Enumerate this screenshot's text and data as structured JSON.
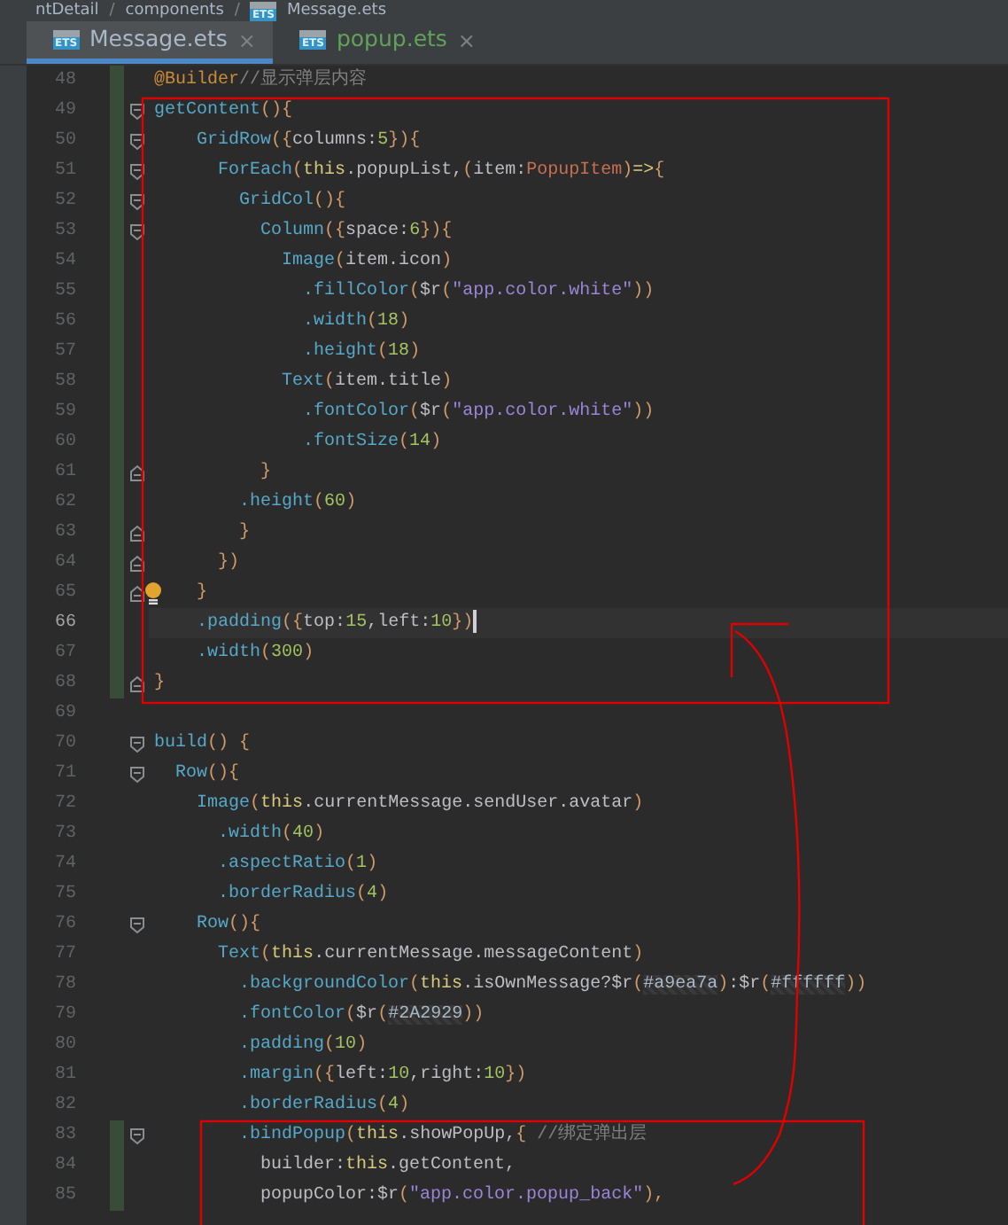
{
  "breadcrumb": [
    {
      "text": "ntDetail"
    },
    {
      "text": "/",
      "kind": "sep"
    },
    {
      "text": "components"
    },
    {
      "text": "/",
      "kind": "sep"
    },
    {
      "text": "Message.ets",
      "icon_label": "ETS"
    }
  ],
  "tabs": [
    {
      "label": "Message.ets",
      "icon_label": "ETS",
      "close": "×",
      "selected": true,
      "modified": false
    },
    {
      "label": "popup.ets",
      "icon_label": "ETS",
      "close": "×",
      "selected": false,
      "modified": true
    }
  ],
  "lines": [
    {
      "number": "48",
      "changed": true,
      "fold_start": false,
      "fold_end": false,
      "tokens": [
        {
          "kind": "ann",
          "text": "@Builder"
        },
        {
          "kind": "cmt",
          "text": "//显示弹层内容"
        }
      ]
    },
    {
      "number": "49",
      "changed": true,
      "fold_start": true,
      "fold_end": false,
      "tokens": [
        {
          "kind": "fn",
          "text": "getContent"
        },
        {
          "kind": "br",
          "text": "(){"
        }
      ]
    },
    {
      "number": "50",
      "changed": true,
      "fold_start": true,
      "fold_end": false,
      "tokens": [
        {
          "kind": "fn",
          "text": "    GridRow"
        },
        {
          "kind": "br",
          "text": "({"
        },
        {
          "kind": "pl",
          "text": "columns:"
        },
        {
          "kind": "num",
          "text": "5"
        },
        {
          "kind": "br",
          "text": "}){"
        }
      ]
    },
    {
      "number": "51",
      "changed": true,
      "fold_start": true,
      "fold_end": false,
      "tokens": [
        {
          "kind": "fn",
          "text": "      ForEach"
        },
        {
          "kind": "br",
          "text": "("
        },
        {
          "kind": "kw",
          "text": "this"
        },
        {
          "kind": "pl",
          "text": ".popupList,"
        },
        {
          "kind": "br",
          "text": "("
        },
        {
          "kind": "pl",
          "text": "item:"
        },
        {
          "kind": "type",
          "text": "PopupItem"
        },
        {
          "kind": "br",
          "text": ")"
        },
        {
          "kind": "kw",
          "text": "=>"
        },
        {
          "kind": "br",
          "text": "{"
        }
      ]
    },
    {
      "number": "52",
      "changed": true,
      "fold_start": true,
      "fold_end": false,
      "tokens": [
        {
          "kind": "fn",
          "text": "        GridCol"
        },
        {
          "kind": "br",
          "text": "(){"
        }
      ]
    },
    {
      "number": "53",
      "changed": true,
      "fold_start": true,
      "fold_end": false,
      "tokens": [
        {
          "kind": "fn",
          "text": "          Column"
        },
        {
          "kind": "br",
          "text": "({"
        },
        {
          "kind": "pl",
          "text": "space:"
        },
        {
          "kind": "num",
          "text": "6"
        },
        {
          "kind": "br",
          "text": "}){"
        }
      ]
    },
    {
      "number": "54",
      "changed": true,
      "fold_start": false,
      "fold_end": false,
      "tokens": [
        {
          "kind": "fn",
          "text": "            Image"
        },
        {
          "kind": "br",
          "text": "("
        },
        {
          "kind": "pl",
          "text": "item.icon"
        },
        {
          "kind": "br",
          "text": ")"
        }
      ]
    },
    {
      "number": "55",
      "changed": true,
      "fold_start": false,
      "fold_end": false,
      "tokens": [
        {
          "kind": "fn",
          "text": "              .fillColor"
        },
        {
          "kind": "br",
          "text": "("
        },
        {
          "kind": "pl",
          "text": "$r"
        },
        {
          "kind": "br",
          "text": "("
        },
        {
          "kind": "str",
          "text": "\"app.color.white\""
        },
        {
          "kind": "br",
          "text": "))"
        }
      ]
    },
    {
      "number": "56",
      "changed": true,
      "fold_start": false,
      "fold_end": false,
      "tokens": [
        {
          "kind": "fn",
          "text": "              .width"
        },
        {
          "kind": "br",
          "text": "("
        },
        {
          "kind": "num",
          "text": "18"
        },
        {
          "kind": "br",
          "text": ")"
        }
      ]
    },
    {
      "number": "57",
      "changed": true,
      "fold_start": false,
      "fold_end": false,
      "tokens": [
        {
          "kind": "fn",
          "text": "              .height"
        },
        {
          "kind": "br",
          "text": "("
        },
        {
          "kind": "num",
          "text": "18"
        },
        {
          "kind": "br",
          "text": ")"
        }
      ]
    },
    {
      "number": "58",
      "changed": true,
      "fold_start": false,
      "fold_end": false,
      "tokens": [
        {
          "kind": "fn",
          "text": "            Text"
        },
        {
          "kind": "br",
          "text": "("
        },
        {
          "kind": "pl",
          "text": "item.title"
        },
        {
          "kind": "br",
          "text": ")"
        }
      ]
    },
    {
      "number": "59",
      "changed": true,
      "fold_start": false,
      "fold_end": false,
      "tokens": [
        {
          "kind": "fn",
          "text": "              .fontColor"
        },
        {
          "kind": "br",
          "text": "("
        },
        {
          "kind": "pl",
          "text": "$r"
        },
        {
          "kind": "br",
          "text": "("
        },
        {
          "kind": "str",
          "text": "\"app.color.white\""
        },
        {
          "kind": "br",
          "text": "))"
        }
      ]
    },
    {
      "number": "60",
      "changed": true,
      "fold_start": false,
      "fold_end": false,
      "tokens": [
        {
          "kind": "fn",
          "text": "              .fontSize"
        },
        {
          "kind": "br",
          "text": "("
        },
        {
          "kind": "num",
          "text": "14"
        },
        {
          "kind": "br",
          "text": ")"
        }
      ]
    },
    {
      "number": "61",
      "changed": true,
      "fold_start": false,
      "fold_end": true,
      "tokens": [
        {
          "kind": "br",
          "text": "          }"
        }
      ]
    },
    {
      "number": "62",
      "changed": true,
      "fold_start": false,
      "fold_end": false,
      "tokens": [
        {
          "kind": "fn",
          "text": "        .height"
        },
        {
          "kind": "br",
          "text": "("
        },
        {
          "kind": "num",
          "text": "60"
        },
        {
          "kind": "br",
          "text": ")"
        }
      ]
    },
    {
      "number": "63",
      "changed": true,
      "fold_start": false,
      "fold_end": true,
      "tokens": [
        {
          "kind": "br",
          "text": "        }"
        }
      ]
    },
    {
      "number": "64",
      "changed": true,
      "fold_start": false,
      "fold_end": true,
      "tokens": [
        {
          "kind": "br",
          "text": "      })"
        }
      ]
    },
    {
      "number": "65",
      "changed": true,
      "fold_start": false,
      "fold_end": true,
      "bulb": true,
      "tokens": [
        {
          "kind": "br",
          "text": "    }"
        }
      ]
    },
    {
      "number": "66",
      "changed": true,
      "fold_start": false,
      "fold_end": false,
      "current": true,
      "tokens": [
        {
          "kind": "fn",
          "text": "    .padding"
        },
        {
          "kind": "br",
          "text": "({"
        },
        {
          "kind": "pl",
          "text": "top:"
        },
        {
          "kind": "num",
          "text": "15"
        },
        {
          "kind": "pl",
          "text": ",left:"
        },
        {
          "kind": "num",
          "text": "10"
        },
        {
          "kind": "br",
          "text": "})"
        }
      ]
    },
    {
      "number": "67",
      "changed": true,
      "fold_start": false,
      "fold_end": false,
      "tokens": [
        {
          "kind": "fn",
          "text": "    .width"
        },
        {
          "kind": "br",
          "text": "("
        },
        {
          "kind": "num",
          "text": "300"
        },
        {
          "kind": "br",
          "text": ")"
        }
      ]
    },
    {
      "number": "68",
      "changed": true,
      "fold_start": false,
      "fold_end": true,
      "tokens": [
        {
          "kind": "br",
          "text": "}"
        }
      ]
    },
    {
      "number": "69",
      "changed": false,
      "fold_start": false,
      "fold_end": false
    },
    {
      "number": "70",
      "changed": false,
      "fold_start": true,
      "fold_end": false,
      "tokens": [
        {
          "kind": "fn",
          "text": "build"
        },
        {
          "kind": "br",
          "text": "() {"
        }
      ]
    },
    {
      "number": "71",
      "changed": false,
      "fold_start": true,
      "fold_end": false,
      "tokens": [
        {
          "kind": "fn",
          "text": "  Row"
        },
        {
          "kind": "br",
          "text": "(){"
        }
      ]
    },
    {
      "number": "72",
      "changed": false,
      "fold_start": false,
      "fold_end": false,
      "tokens": [
        {
          "kind": "fn",
          "text": "    Image"
        },
        {
          "kind": "br",
          "text": "("
        },
        {
          "kind": "kw",
          "text": "this"
        },
        {
          "kind": "pl",
          "text": ".currentMessage.sendUser.avatar"
        },
        {
          "kind": "br",
          "text": ")"
        }
      ]
    },
    {
      "number": "73",
      "changed": false,
      "fold_start": false,
      "fold_end": false,
      "tokens": [
        {
          "kind": "fn",
          "text": "      .width"
        },
        {
          "kind": "br",
          "text": "("
        },
        {
          "kind": "num",
          "text": "40"
        },
        {
          "kind": "br",
          "text": ")"
        }
      ]
    },
    {
      "number": "74",
      "changed": false,
      "fold_start": false,
      "fold_end": false,
      "tokens": [
        {
          "kind": "fn",
          "text": "      .aspectRatio"
        },
        {
          "kind": "br",
          "text": "("
        },
        {
          "kind": "num",
          "text": "1"
        },
        {
          "kind": "br",
          "text": ")"
        }
      ]
    },
    {
      "number": "75",
      "changed": false,
      "fold_start": false,
      "fold_end": false,
      "tokens": [
        {
          "kind": "fn",
          "text": "      .borderRadius"
        },
        {
          "kind": "br",
          "text": "("
        },
        {
          "kind": "num",
          "text": "4"
        },
        {
          "kind": "br",
          "text": ")"
        }
      ]
    },
    {
      "number": "76",
      "changed": false,
      "fold_start": true,
      "fold_end": false,
      "tokens": [
        {
          "kind": "fn",
          "text": "    Row"
        },
        {
          "kind": "br",
          "text": "(){"
        }
      ]
    },
    {
      "number": "77",
      "changed": false,
      "fold_start": false,
      "fold_end": false,
      "tokens": [
        {
          "kind": "fn",
          "text": "      Text"
        },
        {
          "kind": "br",
          "text": "("
        },
        {
          "kind": "kw",
          "text": "this"
        },
        {
          "kind": "pl",
          "text": ".currentMessage.messageContent"
        },
        {
          "kind": "br",
          "text": ")"
        }
      ]
    },
    {
      "number": "78",
      "changed": false,
      "fold_start": false,
      "fold_end": false,
      "tokens": [
        {
          "kind": "fn",
          "text": "        .backgroundColor"
        },
        {
          "kind": "br",
          "text": "("
        },
        {
          "kind": "kw",
          "text": "this"
        },
        {
          "kind": "pl",
          "text": ".isOwnMessage?$r"
        },
        {
          "kind": "br",
          "text": "("
        },
        {
          "kind": "hex",
          "text": "#a9ea7a"
        },
        {
          "kind": "br",
          "text": ")"
        },
        {
          "kind": "pl",
          "text": ":$r"
        },
        {
          "kind": "br",
          "text": "("
        },
        {
          "kind": "hex",
          "text": "#ffffff"
        },
        {
          "kind": "br",
          "text": "))"
        }
      ]
    },
    {
      "number": "79",
      "changed": false,
      "fold_start": false,
      "fold_end": false,
      "tokens": [
        {
          "kind": "fn",
          "text": "        .fontColor"
        },
        {
          "kind": "br",
          "text": "("
        },
        {
          "kind": "pl",
          "text": "$r"
        },
        {
          "kind": "br",
          "text": "("
        },
        {
          "kind": "hex",
          "text": "#2A2929"
        },
        {
          "kind": "br",
          "text": "))"
        }
      ]
    },
    {
      "number": "80",
      "changed": false,
      "fold_start": false,
      "fold_end": false,
      "tokens": [
        {
          "kind": "fn",
          "text": "        .padding"
        },
        {
          "kind": "br",
          "text": "("
        },
        {
          "kind": "num",
          "text": "10"
        },
        {
          "kind": "br",
          "text": ")"
        }
      ]
    },
    {
      "number": "81",
      "changed": false,
      "fold_start": false,
      "fold_end": false,
      "tokens": [
        {
          "kind": "fn",
          "text": "        .margin"
        },
        {
          "kind": "br",
          "text": "({"
        },
        {
          "kind": "pl",
          "text": "left:"
        },
        {
          "kind": "num",
          "text": "10"
        },
        {
          "kind": "pl",
          "text": ",right:"
        },
        {
          "kind": "num",
          "text": "10"
        },
        {
          "kind": "br",
          "text": "})"
        }
      ]
    },
    {
      "number": "82",
      "changed": false,
      "fold_start": false,
      "fold_end": false,
      "tokens": [
        {
          "kind": "fn",
          "text": "        .borderRadius"
        },
        {
          "kind": "br",
          "text": "("
        },
        {
          "kind": "num",
          "text": "4"
        },
        {
          "kind": "br",
          "text": ")"
        }
      ]
    },
    {
      "number": "83",
      "changed": true,
      "fold_start": true,
      "fold_end": false,
      "tokens": [
        {
          "kind": "fn",
          "text": "        .bindPopup"
        },
        {
          "kind": "br",
          "text": "("
        },
        {
          "kind": "kw",
          "text": "this"
        },
        {
          "kind": "pl",
          "text": ".showPopUp,"
        },
        {
          "kind": "br",
          "text": "{"
        },
        {
          "kind": "cmt",
          "text": " //绑定弹出层"
        }
      ]
    },
    {
      "number": "84",
      "changed": true,
      "fold_start": false,
      "fold_end": false,
      "tokens": [
        {
          "kind": "pl",
          "text": "          builder:"
        },
        {
          "kind": "kw",
          "text": "this"
        },
        {
          "kind": "pl",
          "text": ".getContent,"
        }
      ]
    },
    {
      "number": "85",
      "changed": true,
      "fold_start": false,
      "fold_end": false,
      "tokens": [
        {
          "kind": "pl",
          "text": "          popupColor:$r"
        },
        {
          "kind": "br",
          "text": "("
        },
        {
          "kind": "str",
          "text": "\"app.color.popup_back\""
        },
        {
          "kind": "br",
          "text": "),"
        }
      ]
    }
  ]
}
